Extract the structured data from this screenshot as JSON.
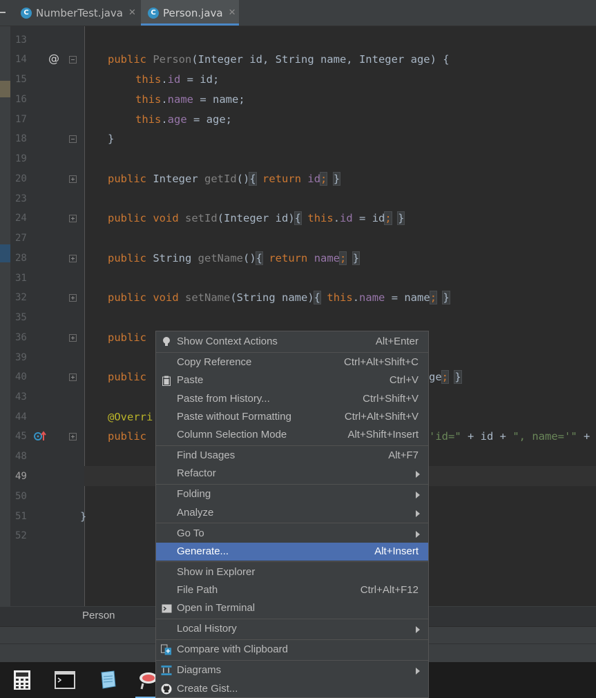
{
  "tabs": [
    {
      "name": "NumberTest.java",
      "icon_letter": "C"
    },
    {
      "name": "Person.java",
      "icon_letter": "C"
    }
  ],
  "editor": {
    "line_numbers": [
      "13",
      "14",
      "15",
      "16",
      "17",
      "18",
      "19",
      "20",
      "23",
      "24",
      "27",
      "28",
      "31",
      "32",
      "35",
      "36",
      "39",
      "40",
      "43",
      "44",
      "45",
      "48",
      "49",
      "50",
      "51",
      "52"
    ],
    "current_line": "49",
    "gutter_markers": {
      "at_marker": "@",
      "override_marker": "overrides-method-icon"
    },
    "code": {
      "l14": {
        "kw": "public",
        "name": "Person",
        "params_a": "(Integer id, String name, Integer age) {"
      },
      "l15": {
        "this": "this",
        "dot": ".",
        "field": "id",
        "rest": " = id;"
      },
      "l16": {
        "this": "this",
        "dot": ".",
        "field": "name",
        "rest": " = name;"
      },
      "l17": {
        "this": "this",
        "dot": ".",
        "field": "age",
        "rest": " = age;"
      },
      "l18": {
        "text": "}"
      },
      "l20": {
        "kw": "public",
        "type": " Integer ",
        "name": "getId",
        "paren": "()",
        "ob": "{",
        "ret": "return",
        "field": "id",
        "semi": ";",
        "cb": "}"
      },
      "l24": {
        "kw": "public",
        "kw2": "void",
        "name": "setId",
        "params": "(Integer id)",
        "ob": "{",
        "this": "this",
        "field": "id",
        "rest": " = id",
        "semi": ";",
        "cb": "}"
      },
      "l28": {
        "kw": "public",
        "type": " String ",
        "name": "getName",
        "paren": "()",
        "ob": "{",
        "ret": "return",
        "field": "name",
        "semi": ";",
        "cb": "}"
      },
      "l32": {
        "kw": "public",
        "kw2": "void",
        "name": "setName",
        "params": "(String name)",
        "ob": "{",
        "this": "this",
        "field": "name",
        "rest": " = name",
        "semi": ";",
        "cb": "}"
      },
      "l36": {
        "kw": "public"
      },
      "l40": {
        "kw": "public",
        "tail": "ge",
        "semi": ";",
        "cb": "}"
      },
      "l44": {
        "ann": "@Overri"
      },
      "l45": {
        "kw": "public",
        "s1": "'id=\"",
        "p1": " + id + ",
        "s2": "\", name='\"",
        "p2": " +"
      },
      "l51": {
        "text": "}"
      }
    },
    "breadcrumb": "Person"
  },
  "context_menu": {
    "items": [
      {
        "label": "Show Context Actions",
        "shortcut": "Alt+Enter",
        "icon": "lightbulb-icon"
      },
      {
        "label": "Copy Reference",
        "shortcut": "Ctrl+Alt+Shift+C"
      },
      {
        "label": "Paste",
        "shortcut": "Ctrl+V",
        "icon": "clipboard-icon"
      },
      {
        "label": "Paste from History...",
        "shortcut": "Ctrl+Shift+V"
      },
      {
        "label": "Paste without Formatting",
        "shortcut": "Ctrl+Alt+Shift+V"
      },
      {
        "label": "Column Selection Mode",
        "shortcut": "Alt+Shift+Insert"
      },
      {
        "label": "Find Usages",
        "shortcut": "Alt+F7"
      },
      {
        "label": "Refactor",
        "submenu": true
      },
      {
        "label": "Folding",
        "submenu": true
      },
      {
        "label": "Analyze",
        "submenu": true
      },
      {
        "label": "Go To",
        "submenu": true
      },
      {
        "label": "Generate...",
        "shortcut": "Alt+Insert",
        "selected": true
      },
      {
        "label": "Show in Explorer"
      },
      {
        "label": "File Path",
        "shortcut": "Ctrl+Alt+F12"
      },
      {
        "label": "Open in Terminal",
        "icon": "terminal-icon"
      },
      {
        "label": "Local History",
        "submenu": true
      },
      {
        "label": "Compare with Clipboard",
        "icon": "compare-icon"
      },
      {
        "label": "Diagrams",
        "submenu": true,
        "icon": "diagram-icon"
      },
      {
        "label": "Create Gist...",
        "icon": "github-icon"
      }
    ]
  },
  "taskbar": {
    "apps": [
      "calculator-icon",
      "cmd-terminal-icon",
      "notepad-icon",
      "app-icon"
    ]
  },
  "colors": {
    "editor_bg": "#2b2b2b",
    "keyword": "#cc7832",
    "field": "#9876aa",
    "method": "#ffc66d",
    "string": "#6a8759",
    "annotation": "#bbb529",
    "menu_selected": "#4b6eaf"
  }
}
